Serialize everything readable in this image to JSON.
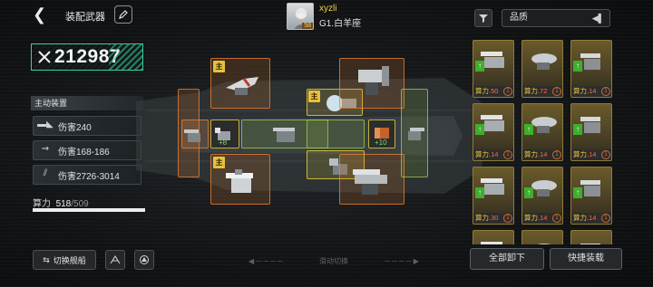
{
  "header": {
    "title": "装配武器",
    "player_name": "xyzli",
    "player_level": "58",
    "player_title": "G1.白羊座"
  },
  "filter": {
    "sort_label": "品质"
  },
  "stats": {
    "combat_power": "212987",
    "skills_header": "主动装置",
    "skills": [
      {
        "icon": "cannon-icon",
        "text": "伤害240"
      },
      {
        "icon": "missile-icon",
        "text": "伤害168-186"
      },
      {
        "icon": "laser-icon",
        "text": "伤害2726-3014"
      }
    ],
    "compute_label": "算力",
    "compute_current": "518",
    "compute_max": "/509",
    "compute_fill": 1.0
  },
  "bottom": {
    "switch_ship": "切换舰船",
    "slide_hint": "滑动切换",
    "unload_all": "全部卸下",
    "quick_equip": "快捷装载"
  },
  "ship": {
    "main_badge": "主",
    "bonus_left": "+8",
    "bonus_right": "+10"
  },
  "inventory": [
    {
      "power_label": "算力.",
      "power": "50",
      "upgrade": true,
      "ammo": "1"
    },
    {
      "power_label": "算力.",
      "power": "72",
      "upgrade": false,
      "ammo": "1"
    },
    {
      "power_label": "算力.",
      "power": "14",
      "upgrade": true,
      "ammo": "1"
    },
    {
      "power_label": "算力.",
      "power": "14",
      "upgrade": true,
      "ammo": "1"
    },
    {
      "power_label": "算力.",
      "power": "14",
      "upgrade": true,
      "ammo": "1"
    },
    {
      "power_label": "算力.",
      "power": "14",
      "upgrade": true,
      "ammo": "1"
    },
    {
      "power_label": "算力.",
      "power": "30",
      "upgrade": true,
      "ammo": "1"
    },
    {
      "power_label": "算力.",
      "power": "14",
      "upgrade": true,
      "ammo": "1"
    },
    {
      "power_label": "算力.",
      "power": "14",
      "upgrade": true,
      "ammo": "1"
    }
  ],
  "colors": {
    "accent_green": "#3ad0a0",
    "slot_orange": "#f08232",
    "slot_green": "#aad746",
    "slot_yellow": "#ebd23c",
    "gold": "#e8c23a"
  }
}
